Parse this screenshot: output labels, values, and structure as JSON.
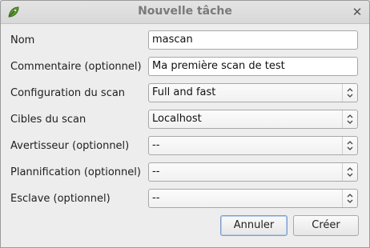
{
  "window": {
    "title": "Nouvelle tâche",
    "app_icon": "leaf-icon",
    "close_icon": "close-icon"
  },
  "form": {
    "fields": [
      {
        "label": "Nom",
        "value": "mascan",
        "type": "text"
      },
      {
        "label": "Commentaire (optionnel)",
        "value": "Ma première scan de test",
        "type": "text"
      },
      {
        "label": "Configuration du scan",
        "value": "Full and fast",
        "type": "select"
      },
      {
        "label": "Cibles du scan",
        "value": "Localhost",
        "type": "select"
      },
      {
        "label": "Avertisseur (optionnel)",
        "value": "--",
        "type": "select"
      },
      {
        "label": "Plannification (optionnel)",
        "value": "--",
        "type": "select"
      },
      {
        "label": "Esclave (optionnel)",
        "value": "--",
        "type": "select"
      }
    ]
  },
  "buttons": {
    "cancel": "Annuler",
    "create": "Créer"
  },
  "colors": {
    "window_bg": "#ededed",
    "title_text": "#7a7a7a",
    "focus_border": "#7b9ccf"
  }
}
